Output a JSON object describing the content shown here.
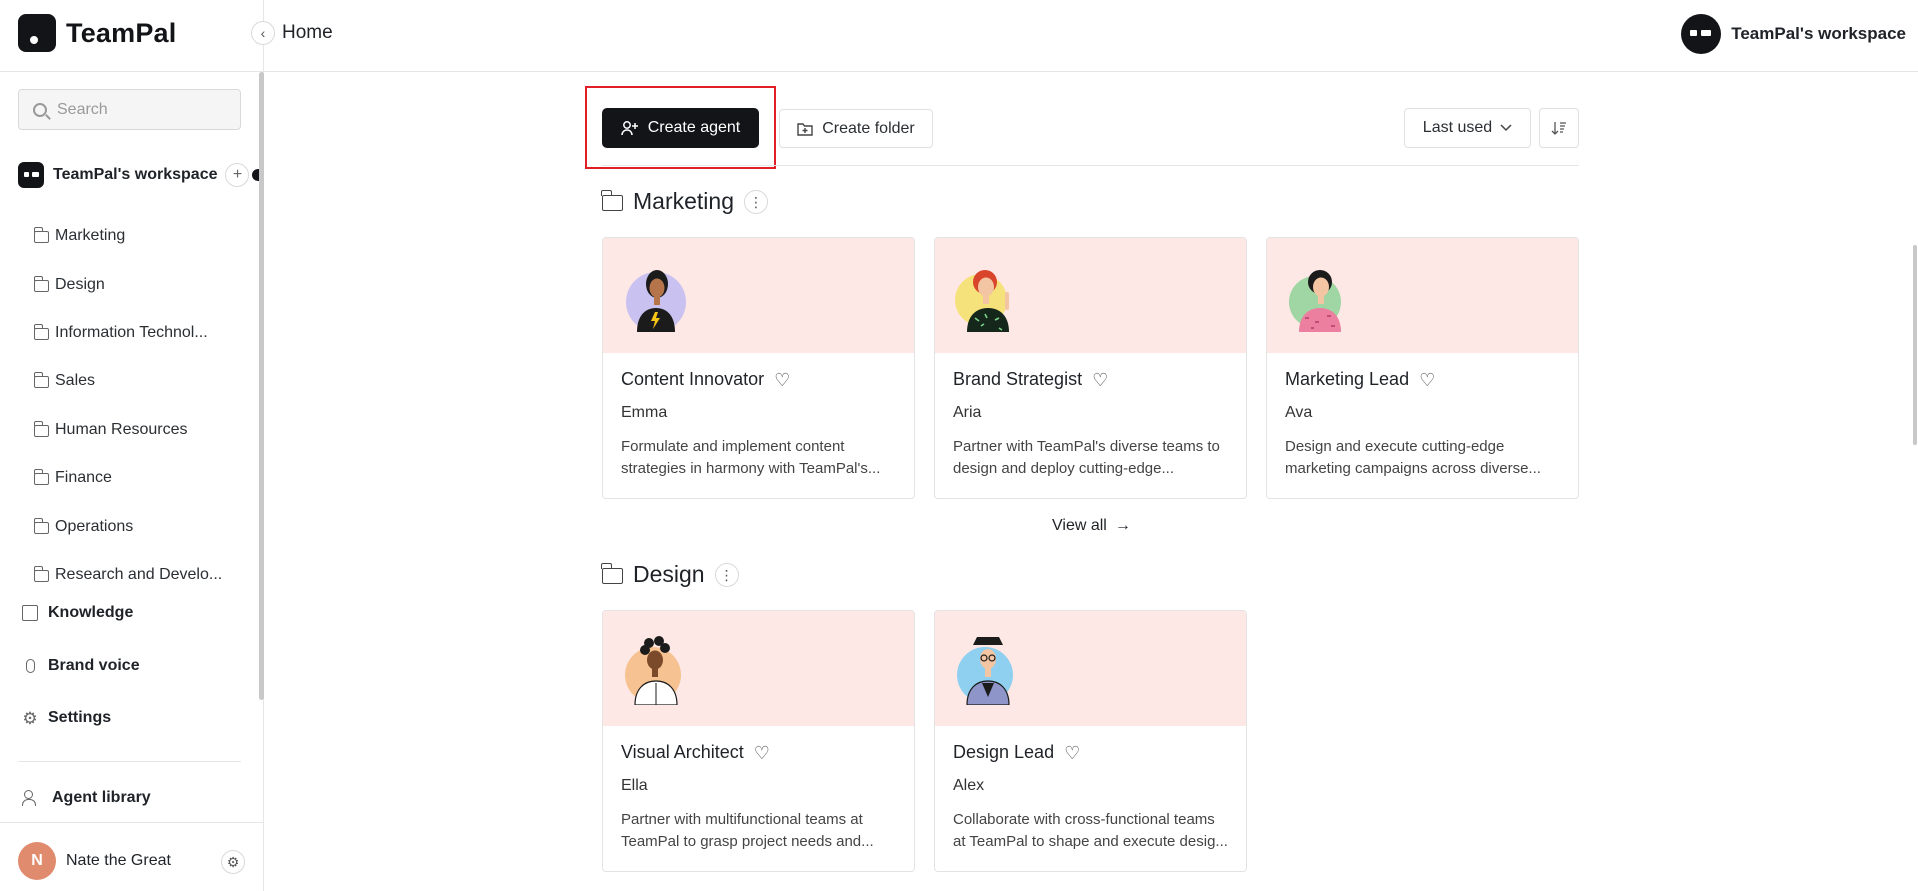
{
  "app": {
    "name": "TeamPal"
  },
  "header": {
    "breadcrumb": "Home",
    "workspace_name": "TeamPal's workspace"
  },
  "sidebar": {
    "search_placeholder": "Search",
    "workspace_name": "TeamPal's workspace",
    "folders": [
      "Marketing",
      "Design",
      "Information Technol...",
      "Sales",
      "Human Resources",
      "Finance",
      "Operations",
      "Research and Develo..."
    ],
    "nav": {
      "knowledge": "Knowledge",
      "brand_voice": "Brand voice",
      "settings": "Settings",
      "agent_library": "Agent library"
    },
    "user": {
      "initial": "N",
      "name": "Nate the Great"
    }
  },
  "toolbar": {
    "create_agent": "Create agent",
    "create_folder": "Create folder",
    "sort_value": "Last used"
  },
  "sections": [
    {
      "title": "Marketing",
      "view_all": "View all",
      "cards": [
        {
          "title": "Content Innovator",
          "person": "Emma",
          "desc": "Formulate and implement content strategies in harmony with TeamPal's...",
          "avatar": "woman-lightning-shirt"
        },
        {
          "title": "Brand Strategist",
          "person": "Aria",
          "desc": "Partner with TeamPal's diverse teams to design and deploy cutting-edge...",
          "avatar": "redhead-pointing"
        },
        {
          "title": "Marketing Lead",
          "person": "Ava",
          "desc": "Design and execute cutting-edge marketing campaigns across diverse...",
          "avatar": "woman-pink-sweater"
        }
      ]
    },
    {
      "title": "Design",
      "cards": [
        {
          "title": "Visual Architect",
          "person": "Ella",
          "desc": "Partner with multifunctional teams at TeamPal to grasp project needs and...",
          "avatar": "curly-hair-white-shirt"
        },
        {
          "title": "Design Lead",
          "person": "Alex",
          "desc": "Collaborate with cross-functional teams at TeamPal to shape and execute desig...",
          "avatar": "hat-glasses-jacket"
        }
      ]
    }
  ],
  "colors": {
    "primary": "#121417",
    "card_banner": "#fde8e6",
    "highlight": "#e21e26",
    "user_avatar": "#e08a6e"
  }
}
